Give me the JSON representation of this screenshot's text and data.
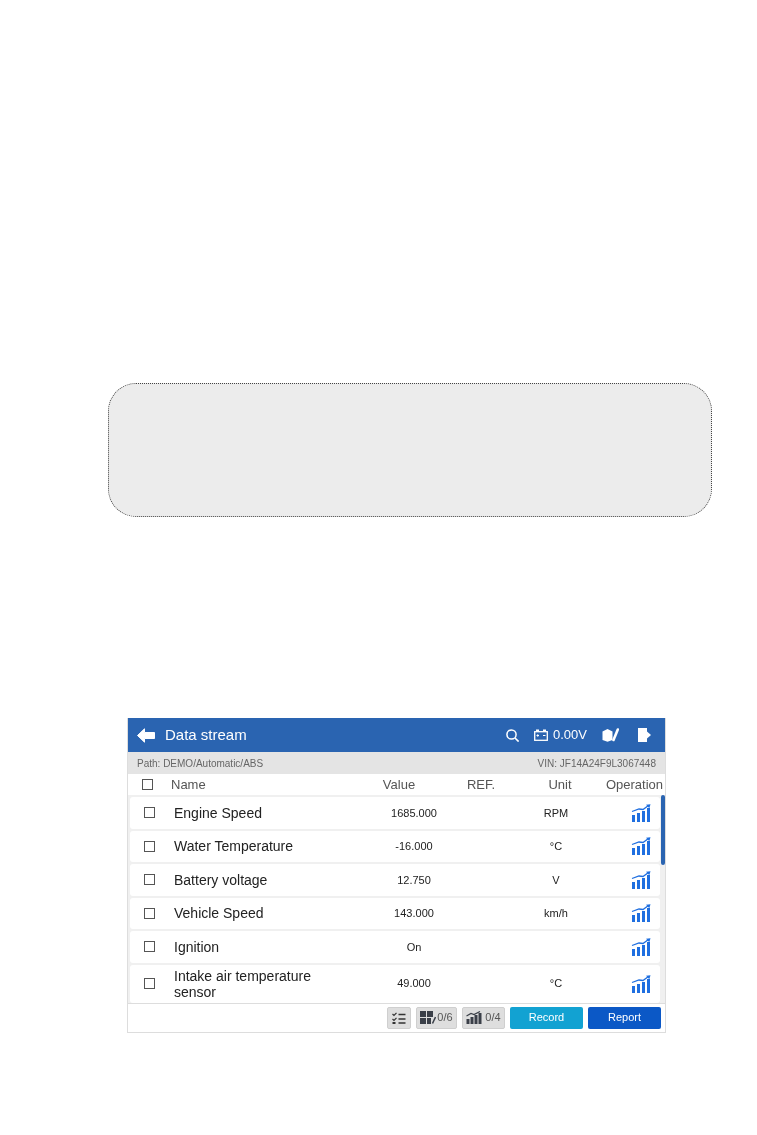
{
  "title_bar": {
    "title": "Data stream",
    "voltage": "0.00V"
  },
  "path_bar": {
    "path": "Path: DEMO/Automatic/ABS",
    "vin": "VIN: JF14A24F9L3067448"
  },
  "table": {
    "select_all": {
      "checked": false
    },
    "columns": [
      "Name",
      "Value",
      "REF.",
      "Unit",
      "Operation"
    ],
    "rows": [
      {
        "checked": false,
        "name": "Engine Speed",
        "value": "1685.000",
        "unit": "RPM"
      },
      {
        "checked": false,
        "name": "Water Temperature",
        "value": "-16.000",
        "unit": "°C"
      },
      {
        "checked": false,
        "name": "Battery voltage",
        "value": "12.750",
        "unit": "V"
      },
      {
        "checked": false,
        "name": "Vehicle Speed",
        "value": "143.000",
        "unit": "km/h"
      },
      {
        "checked": false,
        "name": "Ignition",
        "value": "On"
      },
      {
        "checked": false,
        "name": "Intake air temperature sensor",
        "value": "49.000",
        "unit": "°C"
      }
    ]
  },
  "toolbar": {
    "buttons": [
      {
        "kind": "checklist"
      },
      {
        "kind": "grid",
        "label": "0/6"
      },
      {
        "kind": "graph",
        "label": "0/4"
      },
      {
        "kind": "record",
        "label": "Record"
      },
      {
        "kind": "report",
        "label": "Report"
      }
    ]
  }
}
